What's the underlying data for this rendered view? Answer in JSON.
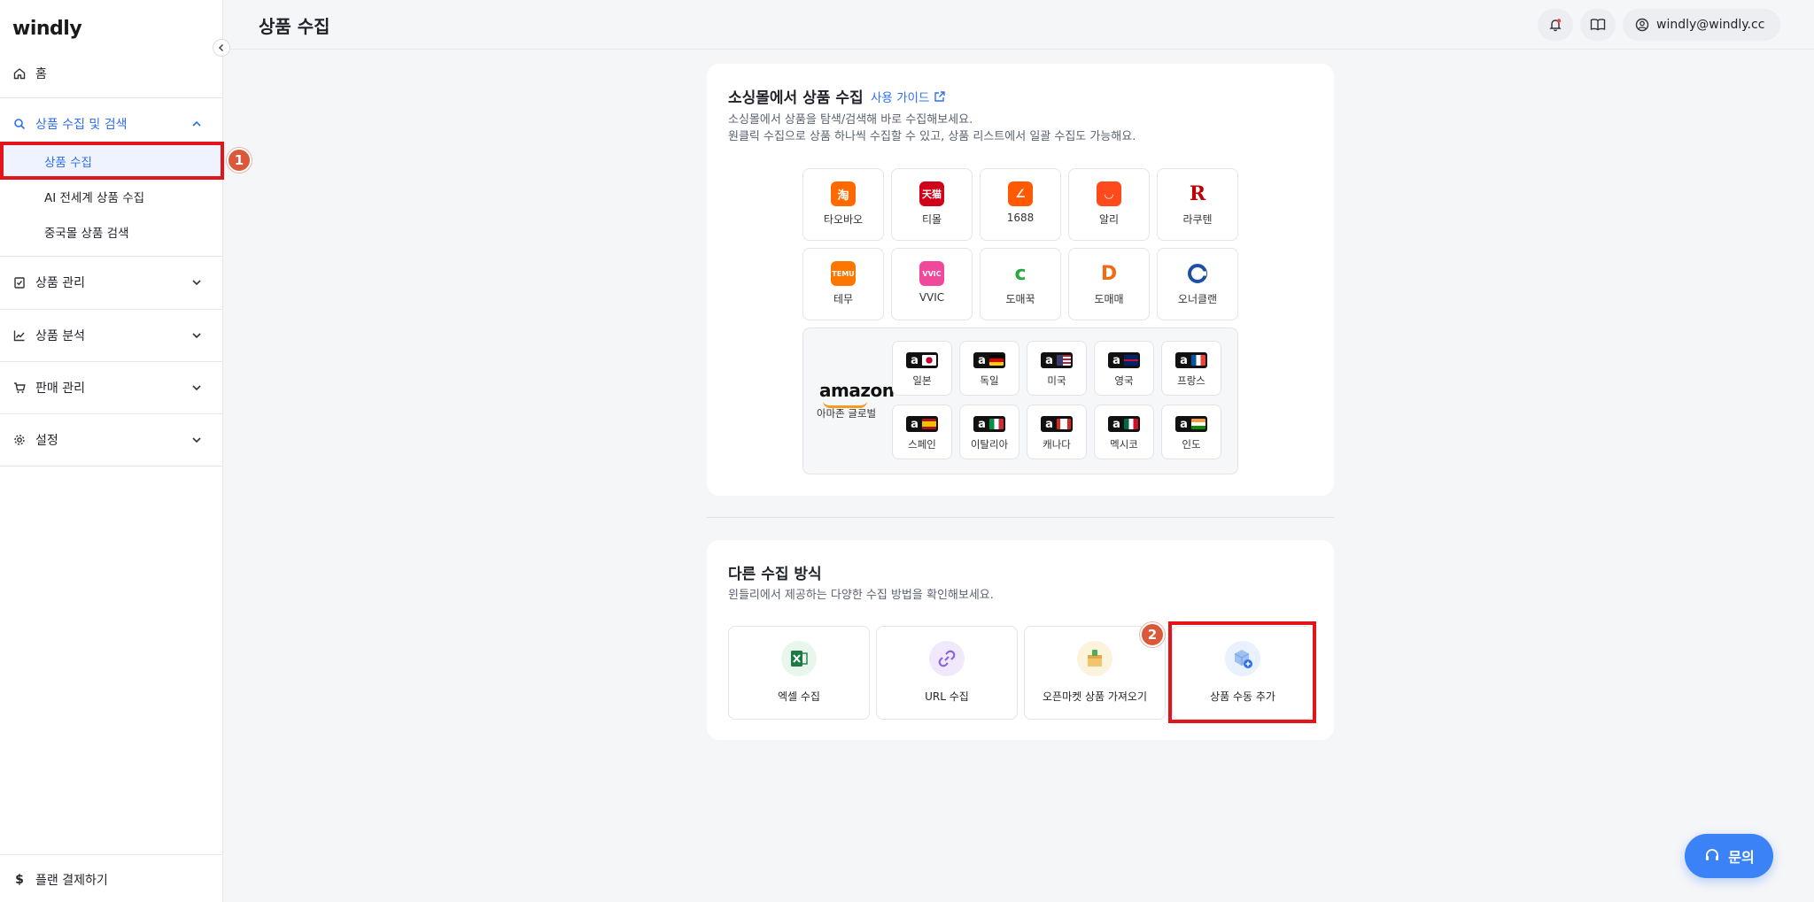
{
  "app": {
    "logo": "windly"
  },
  "sidebar": {
    "home": "홈",
    "group_collect": "상품 수집 및 검색",
    "sub_items": [
      "상품 수집",
      "AI 전세계 상품 수집",
      "중국몰 상품 검색"
    ],
    "groups": [
      "상품 관리",
      "상품 분석",
      "판매 관리",
      "설정"
    ],
    "bottom": "플랜 결제하기"
  },
  "header": {
    "title": "상품 수집",
    "user_email": "windly@windly.cc"
  },
  "social_card": {
    "title": "소싱몰에서 상품 수집",
    "guide": "사용 가이드",
    "desc1": "소싱몰에서 상품을 탐색/검색해 바로 수집해보세요.",
    "desc2": "원클릭 수집으로 상품 하나씩 수집할 수 있고, 상품 리스트에서 일괄 수집도 가능해요.",
    "malls_row1": [
      {
        "label": "타오바오",
        "icon": "taobao-icon",
        "color": "#ff6a00"
      },
      {
        "label": "티몰",
        "icon": "tmall-icon",
        "color": "#d0021b"
      },
      {
        "label": "1688",
        "icon": "1688-icon",
        "color": "#ff5a00"
      },
      {
        "label": "알리",
        "icon": "aliexpress-icon",
        "color": "#ff4a1c"
      },
      {
        "label": "라쿠텐",
        "icon": "rakuten-icon",
        "color": "#bf0000"
      }
    ],
    "malls_row2": [
      {
        "label": "테무",
        "icon": "temu-icon",
        "color": "#fb7701"
      },
      {
        "label": "VVIC",
        "icon": "vvic-icon",
        "color": "#f0489a"
      },
      {
        "label": "도매꾹",
        "icon": "domeggook-icon",
        "color": "#27a844"
      },
      {
        "label": "도매매",
        "icon": "domeme-icon",
        "color": "#f06a13"
      },
      {
        "label": "오너클랜",
        "icon": "ownerclan-icon",
        "color": "#1f4fa3"
      }
    ],
    "amazon": {
      "logo": "amazon",
      "label": "아마존 글로벌",
      "a_glyph": "a",
      "row1": [
        "일본",
        "독일",
        "미국",
        "영국",
        "프랑스"
      ],
      "row2": [
        "스페인",
        "이탈리아",
        "캐나다",
        "멕시코",
        "인도"
      ]
    }
  },
  "other_card": {
    "title": "다른 수집 방식",
    "desc": "윈들리에서 제공하는 다양한 수집 방법을 확인해보세요.",
    "methods": [
      "엑셀 수집",
      "URL 수집",
      "오픈마켓 상품 가져오기",
      "상품 수동 추가"
    ]
  },
  "annotations": {
    "badge1": "1",
    "badge2": "2",
    "highlight_color": "#e4141b"
  },
  "inquiry_button": "문의"
}
